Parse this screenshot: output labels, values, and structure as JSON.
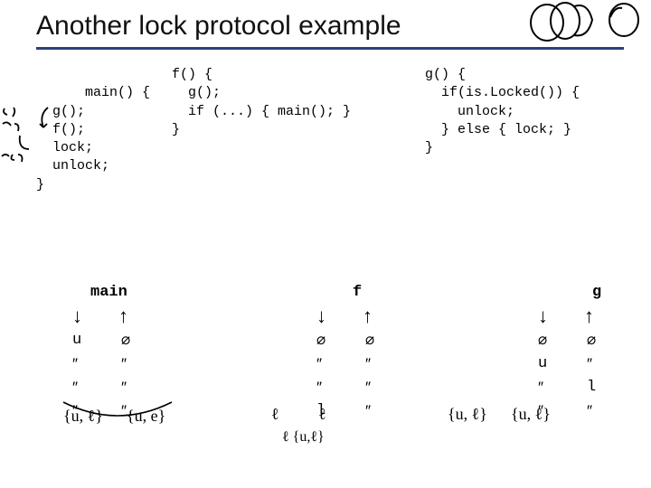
{
  "title": "Another lock protocol example",
  "code": {
    "main": "main() {\n  g();\n  f();\n  lock;\n  unlock;\n}",
    "f": "f() {\n  g();\n  if (...) { main(); }\n}",
    "g": "g() {\n  if(is.Locked()) {\n    unlock;\n  } else { lock; }\n}"
  },
  "labels": {
    "main": "main",
    "f": "f",
    "g": "g"
  },
  "arrows": {
    "down": "↓",
    "up": "↑"
  },
  "symbols": {
    "empty": "∅",
    "ditto": "″",
    "u": "u",
    "l": "l"
  },
  "table": {
    "main": {
      "left": [
        "u",
        "ditto",
        "ditto",
        "ditto"
      ],
      "right": [
        "empty",
        "ditto",
        "ditto",
        "ditto"
      ]
    },
    "f": {
      "left": [
        "empty",
        "ditto",
        "ditto",
        "l"
      ],
      "right": [
        "empty",
        "ditto",
        "ditto",
        "ditto"
      ]
    },
    "g": {
      "left": [
        "empty",
        "u",
        "ditto",
        "ditto"
      ],
      "right": [
        "empty",
        "ditto",
        "l",
        "ditto"
      ]
    }
  },
  "hand": {
    "left1": "h ℓ",
    "left2": "ℓ e",
    "left3": "u, ℓ",
    "bottom_main_l": "{u, ℓ}",
    "bottom_main_r": "{u, e}",
    "bottom_f_l": "ℓ",
    "bottom_f_r1": "ℓ",
    "bottom_f_r2": "ℓ  {u,ℓ}",
    "bottom_g_l": "{u, ℓ}",
    "bottom_g_r": "{u, ℓ}"
  }
}
